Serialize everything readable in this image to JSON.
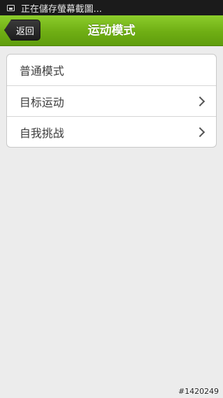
{
  "status_bar": {
    "icon": "screenshot-icon",
    "text": "正在儲存螢幕截圖..."
  },
  "header": {
    "back_label": "返回",
    "title": "运动模式",
    "accent_color": "#7ab91e"
  },
  "menu": {
    "items": [
      {
        "label": "普通模式",
        "has_chevron": false
      },
      {
        "label": "目标运动",
        "has_chevron": true
      },
      {
        "label": "自我挑战",
        "has_chevron": true
      }
    ]
  },
  "watermark": "#1420249"
}
